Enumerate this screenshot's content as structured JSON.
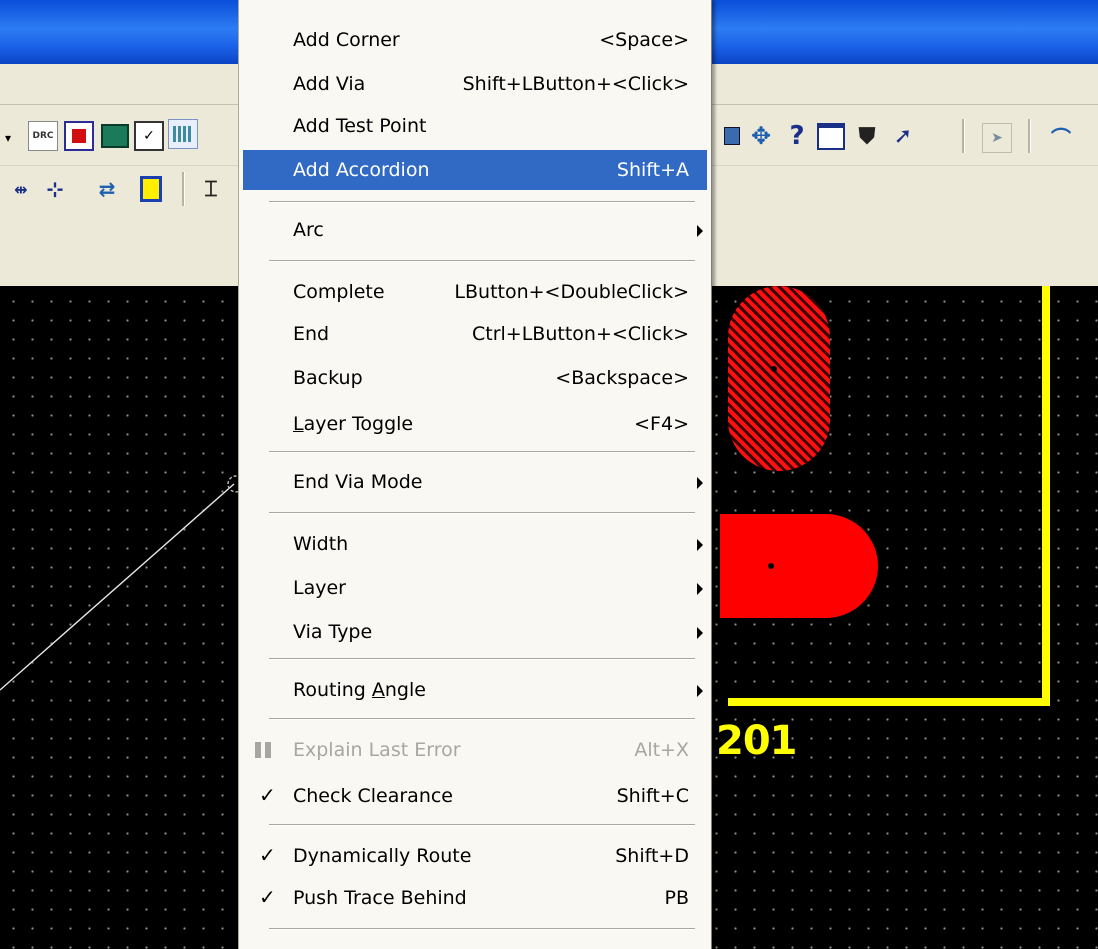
{
  "canvas": {
    "refdes": "201"
  },
  "context_menu": {
    "items": [
      {
        "label": "Add Corner",
        "shortcut": "<Space>"
      },
      {
        "label": "Add Via",
        "shortcut": "Shift+LButton+<Click>"
      },
      {
        "label": "Add Test Point",
        "shortcut": ""
      },
      {
        "label": "Add Accordion",
        "shortcut": "Shift+A",
        "highlighted": true
      },
      {
        "label": "Arc",
        "submenu": true
      },
      {
        "label": "Complete",
        "shortcut": "LButton+<DoubleClick>"
      },
      {
        "label": "End",
        "shortcut": "Ctrl+LButton+<Click>"
      },
      {
        "label": "Backup",
        "shortcut": "<Backspace>"
      },
      {
        "label_mn": "L",
        "label_rest": "ayer Toggle",
        "shortcut": "<F4>"
      },
      {
        "label": "End Via Mode",
        "submenu": true
      },
      {
        "label": "Width",
        "submenu": true
      },
      {
        "label": "Layer",
        "submenu": true
      },
      {
        "label": "Via Type",
        "submenu": true
      },
      {
        "label_pre": "Routing ",
        "label_mn": "A",
        "label_rest": "ngle",
        "submenu": true
      },
      {
        "label": "Explain Last Error",
        "shortcut": "Alt+X",
        "disabled": true
      },
      {
        "label": "Check Clearance",
        "shortcut": "Shift+C",
        "checked": true
      },
      {
        "label": "Dynamically Route",
        "shortcut": "Shift+D",
        "checked": true
      },
      {
        "label": "Push Trace Behind",
        "shortcut": "PB",
        "checked": true
      }
    ]
  },
  "toolbar": {
    "icons": [
      "drc-filter-icon",
      "pause-icon",
      "component-icon",
      "document-check-icon",
      "grid-icon",
      "component-small-icon",
      "move-icon",
      "help-icon",
      "window-icon",
      "properties-icon",
      "whats-this-icon",
      "select-arrow-icon",
      "route-icon",
      "tune-icon",
      "insert-icon",
      "swap-icon",
      "part-icon",
      "measure-icon"
    ],
    "help_glyph": "?",
    "drc_glyph": "DRC",
    "checkmark": "✓"
  },
  "colors": {
    "title_blue": "#0a4ed9",
    "menu_highlight": "#316ac5",
    "pad_red": "#ff0000",
    "outline_yellow": "#ffff00",
    "canvas_black": "#000000"
  }
}
